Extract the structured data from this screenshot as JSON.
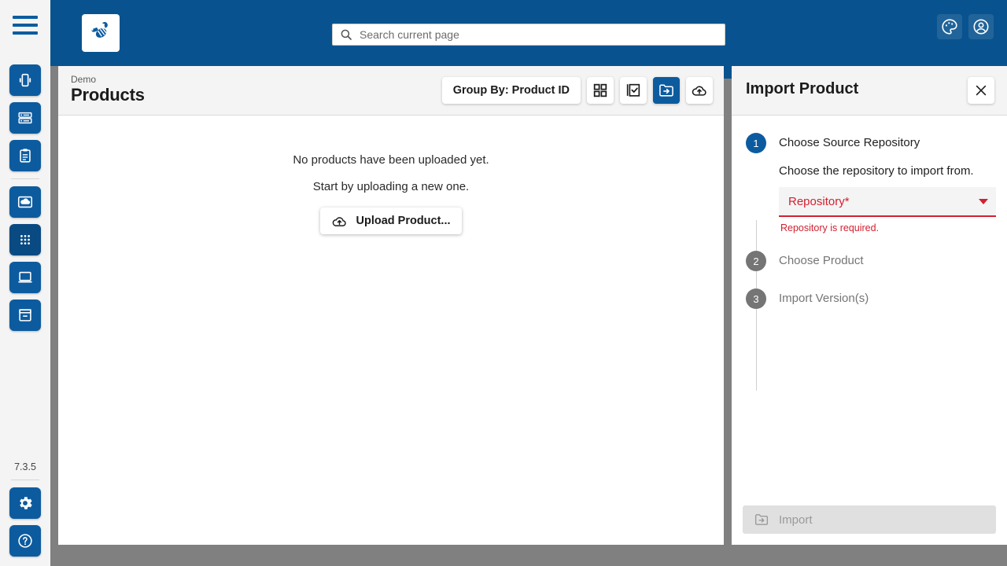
{
  "app": {
    "logo_icon": "bee-logo-icon",
    "version": "7.3.5",
    "accent_blue": "#0d5b9f",
    "header_blue": "#08538f",
    "error_red": "#d32030"
  },
  "rail": {
    "menu_icon": "hamburger-menu-icon",
    "items": [
      {
        "icon": "devices-icon",
        "name": "sidebar-item-devices",
        "active": false
      },
      {
        "icon": "list-icon",
        "name": "sidebar-item-list",
        "active": false
      },
      {
        "icon": "clipboard-icon",
        "name": "sidebar-item-tasks",
        "active": false
      },
      {
        "icon": "cloud-image-icon",
        "name": "sidebar-item-images",
        "active": false
      },
      {
        "icon": "apps-grid-icon",
        "name": "sidebar-item-apps",
        "active": true
      },
      {
        "icon": "laptop-icon",
        "name": "sidebar-item-workstations",
        "active": false
      },
      {
        "icon": "archive-icon",
        "name": "sidebar-item-archive",
        "active": false
      }
    ],
    "bottom_items": [
      {
        "icon": "gear-icon",
        "name": "sidebar-item-settings"
      },
      {
        "icon": "help-circle-icon",
        "name": "sidebar-item-help"
      }
    ]
  },
  "header": {
    "search": {
      "placeholder": "Search current page",
      "value": "",
      "icon": "search-icon"
    },
    "actions": [
      {
        "icon": "palette-icon",
        "name": "theme-button"
      },
      {
        "icon": "account-circle-icon",
        "name": "account-button"
      }
    ]
  },
  "main": {
    "breadcrumb": "Demo",
    "title": "Products",
    "toolbar": {
      "group_by_label": "Group By: Product ID",
      "buttons": [
        {
          "icon": "grid-view-icon",
          "name": "grid-view-button",
          "active": false
        },
        {
          "icon": "select-all-icon",
          "name": "select-all-button",
          "active": false
        },
        {
          "icon": "import-folder-icon",
          "name": "import-product-button",
          "active": true
        },
        {
          "icon": "cloud-upload-icon",
          "name": "upload-cloud-button",
          "active": false
        }
      ]
    },
    "empty_state": {
      "line1": "No products have been uploaded yet.",
      "line2": "Start by uploading a new one.",
      "upload_label": "Upload Product...",
      "upload_icon": "cloud-upload-icon"
    }
  },
  "panel": {
    "title": "Import Product",
    "close_icon": "close-icon",
    "steps": [
      {
        "number": "1",
        "label": "Choose Source Repository",
        "active": true,
        "description": "Choose the repository to import from.",
        "field": {
          "label": "Repository*",
          "value": "",
          "error": "Repository is required.",
          "caret_icon": "chevron-down-icon"
        }
      },
      {
        "number": "2",
        "label": "Choose Product",
        "active": false
      },
      {
        "number": "3",
        "label": "Import Version(s)",
        "active": false
      }
    ],
    "footer": {
      "import_label": "Import",
      "import_icon": "import-folder-icon",
      "disabled": true
    }
  }
}
